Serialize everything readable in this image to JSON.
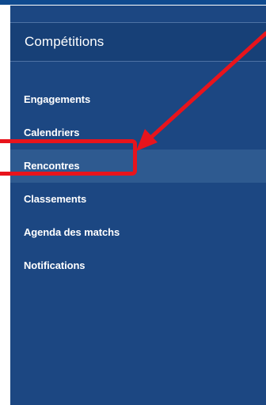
{
  "sidebar": {
    "title": "Compétitions",
    "items": [
      {
        "label": "Engagements"
      },
      {
        "label": "Calendriers"
      },
      {
        "label": "Rencontres",
        "active": true
      },
      {
        "label": "Classements"
      },
      {
        "label": "Agenda des matchs"
      },
      {
        "label": "Notifications"
      }
    ]
  },
  "colors": {
    "sidebar_background": "#1c4782",
    "header_background": "#174077",
    "active_item_background": "#2e5a90",
    "text": "#ffffff",
    "annotation_red": "#e8141c"
  },
  "annotation": {
    "type": "arrow-and-box",
    "target": "Rencontres"
  }
}
